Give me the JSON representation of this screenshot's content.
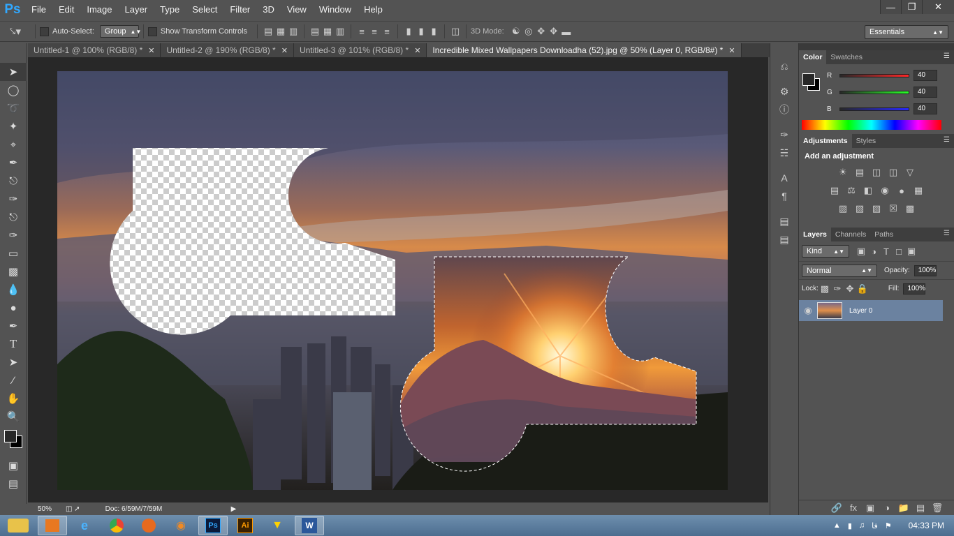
{
  "app": {
    "logo": "Ps"
  },
  "menu": [
    "File",
    "Edit",
    "Image",
    "Layer",
    "Type",
    "Select",
    "Filter",
    "3D",
    "View",
    "Window",
    "Help"
  ],
  "options": {
    "auto_select_label": "Auto-Select:",
    "auto_select_value": "Group",
    "show_transform_label": "Show Transform Controls",
    "mode_3d_label": "3D Mode:",
    "workspace": "Essentials"
  },
  "tabs": [
    {
      "label": "Untitled-1 @ 100% (RGB/8) *"
    },
    {
      "label": "Untitled-2 @ 190% (RGB/8) *"
    },
    {
      "label": "Untitled-3 @ 101% (RGB/8) *"
    },
    {
      "label": "Incredible Mixed Wallpapers Downloadha (52).jpg @ 50% (Layer 0, RGB/8#) *"
    }
  ],
  "status": {
    "zoom": "50%",
    "doc": "Doc: 6/59M/7/59M"
  },
  "color_panel": {
    "tabs": [
      "Color",
      "Swatches"
    ],
    "channels": [
      {
        "label": "R",
        "value": "40",
        "color": "#d02020"
      },
      {
        "label": "G",
        "value": "40",
        "color": "#20c020"
      },
      {
        "label": "B",
        "value": "40",
        "color": "#2040e0"
      }
    ]
  },
  "adjustments_panel": {
    "tabs": [
      "Adjustments",
      "Styles"
    ],
    "heading": "Add an adjustment"
  },
  "layers_panel": {
    "tabs": [
      "Layers",
      "Channels",
      "Paths"
    ],
    "kind": "Kind",
    "blend_mode": "Normal",
    "opacity_label": "Opacity:",
    "opacity_value": "100%",
    "lock_label": "Lock:",
    "fill_label": "Fill:",
    "fill_value": "100%",
    "layer_name": "Layer 0"
  },
  "taskbar": {
    "time": "04:33 PM",
    "lang": "فا"
  }
}
